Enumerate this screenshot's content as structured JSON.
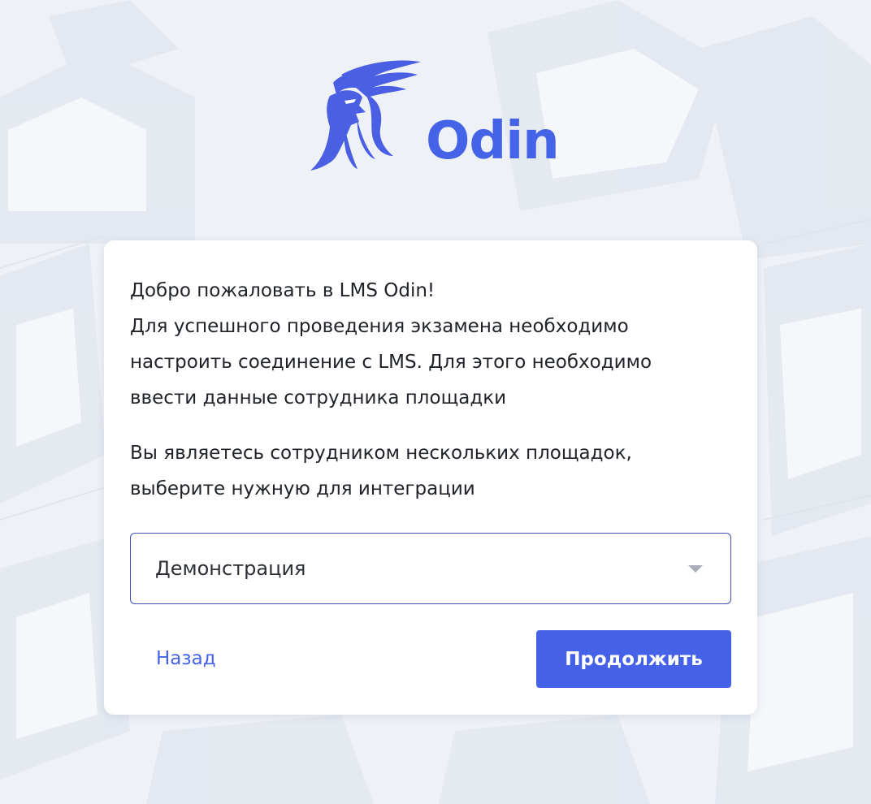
{
  "brand": {
    "name": "Odin",
    "logo_icon": "odin-viking-head-icon",
    "color": "#4563e6"
  },
  "dialog": {
    "intro_lines": [
      "Добро пожаловать в LMS Odin!",
      "Для успешного проведения экзамена необходимо",
      "настроить соединение с LMS. Для этого необходимо",
      "ввести данные сотрудника площадки"
    ],
    "choose_lines": [
      "Вы являетесь сотрудником нескольких площадок,",
      "выберите нужную для интеграции"
    ],
    "site_select": {
      "selected": "Демонстрация",
      "icon": "caret-down-icon"
    },
    "back_label": "Назад",
    "continue_label": "Продолжить",
    "accent_color": "#4461e8"
  }
}
